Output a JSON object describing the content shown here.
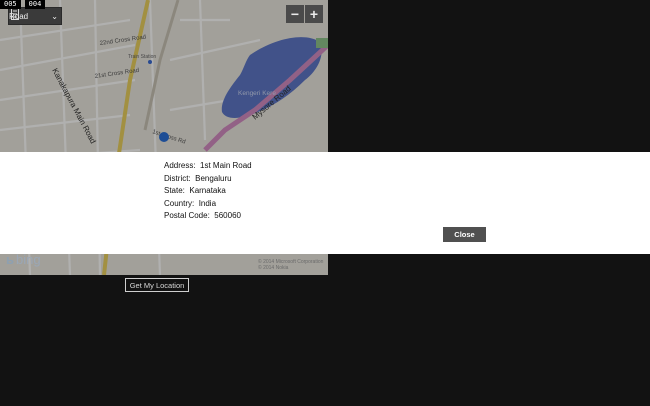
{
  "debug_counters": [
    "005",
    "004"
  ],
  "map": {
    "style_label": "Road",
    "zoom_out_label": "−",
    "zoom_in_label": "+",
    "street_labels": [
      "Kanakapura Main Road",
      "Mysore Road",
      "22nd Cross Road",
      "21st Cross Road",
      "Train Station",
      "1st Cross Rd",
      "Kengeri Kere"
    ],
    "logo_text": "bing",
    "copyright_lines": [
      "© 2014 Microsoft Corporation",
      "© 2014 Nokia"
    ],
    "colors": {
      "lake": "#5d76c5",
      "main_road": "#e8cf5e",
      "location_dot": "#2a6fd6"
    }
  },
  "dialog": {
    "address_label": "Address:",
    "address_value": "1st Main Road",
    "district_label": "District:",
    "district_value": "Bengaluru",
    "state_label": "State:",
    "state_value": "Karnataka",
    "country_label": "Country:",
    "country_value": "India",
    "postal_label": "Postal Code:",
    "postal_value": "560060",
    "close_label": "Close"
  },
  "get_location_label": "Get My Location"
}
